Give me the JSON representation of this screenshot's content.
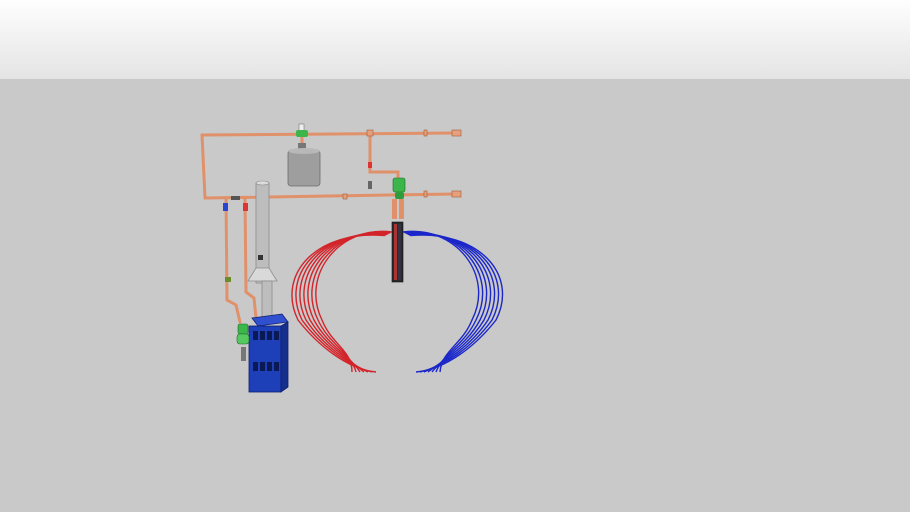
{
  "scene": {
    "environment": {
      "sky_color": "#f2f2f2",
      "ground_color": "#c9c9c9"
    },
    "components": [
      {
        "name": "boiler",
        "color": "#1d3fb8"
      },
      {
        "name": "flue-pipe",
        "color": "#b9b9b9"
      },
      {
        "name": "expansion-tank",
        "color": "#9e9e9e"
      },
      {
        "name": "copper-piping",
        "color": "#e0916a"
      },
      {
        "name": "circulator-pump",
        "color": "#3cb54a"
      },
      {
        "name": "manifold",
        "color": "#2a2a2a"
      },
      {
        "name": "supply-tubing-loops",
        "color": "#d3242b"
      },
      {
        "name": "return-tubing-loops",
        "color": "#1b27c9"
      }
    ],
    "supply_loop_count": 7,
    "return_loop_count": 7
  }
}
